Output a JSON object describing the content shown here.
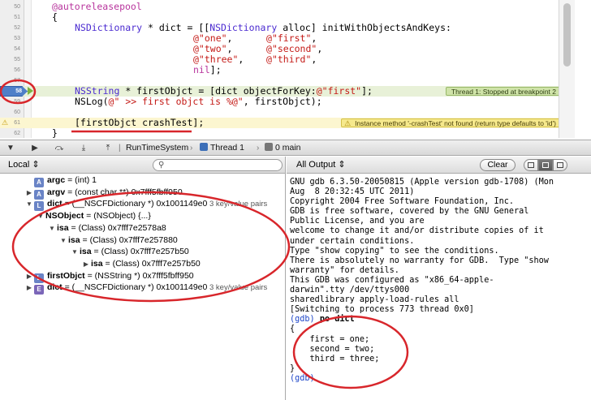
{
  "editor": {
    "lines": [
      {
        "n": "50",
        "code": [
          [
            "kw",
            "@autoreleasepool"
          ]
        ],
        "indent": 0
      },
      {
        "n": "51",
        "code": [
          [
            "",
            "{"
          ]
        ],
        "indent": 0
      },
      {
        "n": "52",
        "code": [
          [
            "cls",
            "NSDictionary"
          ],
          [
            "",
            " * dict = [["
          ],
          [
            "cls",
            "NSDictionary"
          ],
          [
            "",
            " alloc] initWithObjectsAndKeys:"
          ]
        ],
        "indent": 1
      },
      {
        "n": "53",
        "code": [
          [
            "str",
            "@\"one\""
          ],
          [
            "",
            ",      "
          ],
          [
            "str",
            "@\"first\""
          ],
          [
            "",
            ","
          ]
        ],
        "indent": 2
      },
      {
        "n": "54",
        "code": [
          [
            "str",
            "@\"two\""
          ],
          [
            "",
            ",      "
          ],
          [
            "str",
            "@\"second\""
          ],
          [
            "",
            ","
          ]
        ],
        "indent": 2
      },
      {
        "n": "55",
        "code": [
          [
            "str",
            "@\"three\""
          ],
          [
            "",
            ",    "
          ],
          [
            "str",
            "@\"third\""
          ],
          [
            "",
            ","
          ]
        ],
        "indent": 2
      },
      {
        "n": "56",
        "code": [
          [
            "kw",
            "nil"
          ],
          [
            "",
            "];"
          ]
        ],
        "indent": 2
      },
      {
        "n": "57",
        "code": [],
        "indent": 1
      },
      {
        "n": "58",
        "code": [
          [
            "cls",
            "NSString"
          ],
          [
            "",
            " * firstObjct = [dict objectForKey:"
          ],
          [
            "str",
            "@\"first\""
          ],
          [
            "",
            "];"
          ]
        ],
        "indent": 1,
        "breakpoint": true
      },
      {
        "n": "59",
        "code": [
          [
            "",
            "NSLog("
          ],
          [
            "str",
            "@\" >> first objct is %@\""
          ],
          [
            "",
            ", firstObjct);"
          ]
        ],
        "indent": 1
      },
      {
        "n": "60",
        "code": [],
        "indent": 1
      },
      {
        "n": "61",
        "code": [
          [
            "",
            "[firstObjct crashTest];"
          ]
        ],
        "indent": 1,
        "warning": true
      },
      {
        "n": "62",
        "code": [
          [
            "",
            "}"
          ]
        ],
        "indent": 0
      }
    ],
    "thread_badge": "Thread 1: Stopped at breakpoint 2",
    "warning_badge": "Instance method '-crashTest' not found (return type defaults to 'id')"
  },
  "debugbar": {
    "buttons": [
      {
        "name": "hide-debug-area-button",
        "glyph": "▼"
      },
      {
        "name": "continue-button",
        "glyph": "▶"
      },
      {
        "name": "step-over-button",
        "glyph": "⤼"
      },
      {
        "name": "step-into-button",
        "glyph": "⤓"
      },
      {
        "name": "step-out-button",
        "glyph": "⤒"
      }
    ],
    "crumbs": [
      "RunTimeSystem",
      "Thread 1",
      "0 main"
    ]
  },
  "variables": {
    "scope": "Local",
    "rows": [
      {
        "indent": 0,
        "disc": "",
        "badge": "A",
        "name": "argc",
        "value": " = (int) 1",
        "pairs": ""
      },
      {
        "indent": 0,
        "disc": "▶",
        "badge": "A",
        "name": "argv",
        "value": " = (const char **) 0x7fff5fbff950",
        "pairs": ""
      },
      {
        "indent": 0,
        "disc": "▼",
        "badge": "L",
        "name": "dict",
        "value": " = (__NSCFDictionary *) 0x1001149e0",
        "pairs": " 3 key/value pairs"
      },
      {
        "indent": 1,
        "disc": "▼",
        "badge": "",
        "name": "NSObject",
        "value": " = (NSObject) {...}",
        "pairs": ""
      },
      {
        "indent": 2,
        "disc": "▼",
        "badge": "",
        "name": "isa",
        "value": " = (Class) 0x7fff7e2578a8",
        "pairs": ""
      },
      {
        "indent": 3,
        "disc": "▼",
        "badge": "",
        "name": "isa",
        "value": " = (Class) 0x7fff7e257880",
        "pairs": ""
      },
      {
        "indent": 4,
        "disc": "▼",
        "badge": "",
        "name": "isa",
        "value": " = (Class) 0x7fff7e257b50",
        "pairs": ""
      },
      {
        "indent": 5,
        "disc": "▶",
        "badge": "",
        "name": "isa",
        "value": " = (Class) 0x7fff7e257b50",
        "pairs": ""
      },
      {
        "indent": 0,
        "disc": "▶",
        "badge": "L",
        "name": "firstObjct",
        "value": " = (NSString *) 0x7fff5fbff950",
        "pairs": ""
      },
      {
        "indent": 0,
        "disc": "▶",
        "badge": "E",
        "name": "dict",
        "value": " = (__NSCFDictionary *) 0x1001149e0",
        "pairs": " 3 key/value pairs"
      }
    ],
    "search_placeholder": ""
  },
  "console": {
    "output_selector": "All Output",
    "clear_label": "Clear",
    "lines": [
      {
        "t": "GNU gdb 6.3.50-20050815 (Apple version gdb-1708) (Mon"
      },
      {
        "t": "Aug  8 20:32:45 UTC 2011)"
      },
      {
        "t": "Copyright 2004 Free Software Foundation, Inc."
      },
      {
        "t": "GDB is free software, covered by the GNU General"
      },
      {
        "t": "Public License, and you are"
      },
      {
        "t": "welcome to change it and/or distribute copies of it"
      },
      {
        "t": "under certain conditions."
      },
      {
        "t": "Type \"show copying\" to see the conditions."
      },
      {
        "t": "There is absolutely no warranty for GDB.  Type \"show"
      },
      {
        "t": "warranty\" for details."
      },
      {
        "t": "This GDB was configured as \"x86_64-apple-"
      },
      {
        "t": "darwin\".tty /dev/ttys000"
      },
      {
        "t": "sharedlibrary apply-load-rules all"
      },
      {
        "t": "[Switching to process 773 thread 0x0]"
      },
      {
        "p": "(gdb) ",
        "t": "po dict"
      },
      {
        "t": "{"
      },
      {
        "t": "    first = one;"
      },
      {
        "t": "    second = two;"
      },
      {
        "t": "    third = three;"
      },
      {
        "t": "}"
      },
      {
        "p": "(gdb)",
        "t": ""
      }
    ]
  },
  "colors": {
    "annotation_red": "#d8262b",
    "breakpoint_blue": "#4f7fc8",
    "keyword": "#b8359d",
    "string": "#c41a16",
    "class": "#4a2ad0"
  }
}
